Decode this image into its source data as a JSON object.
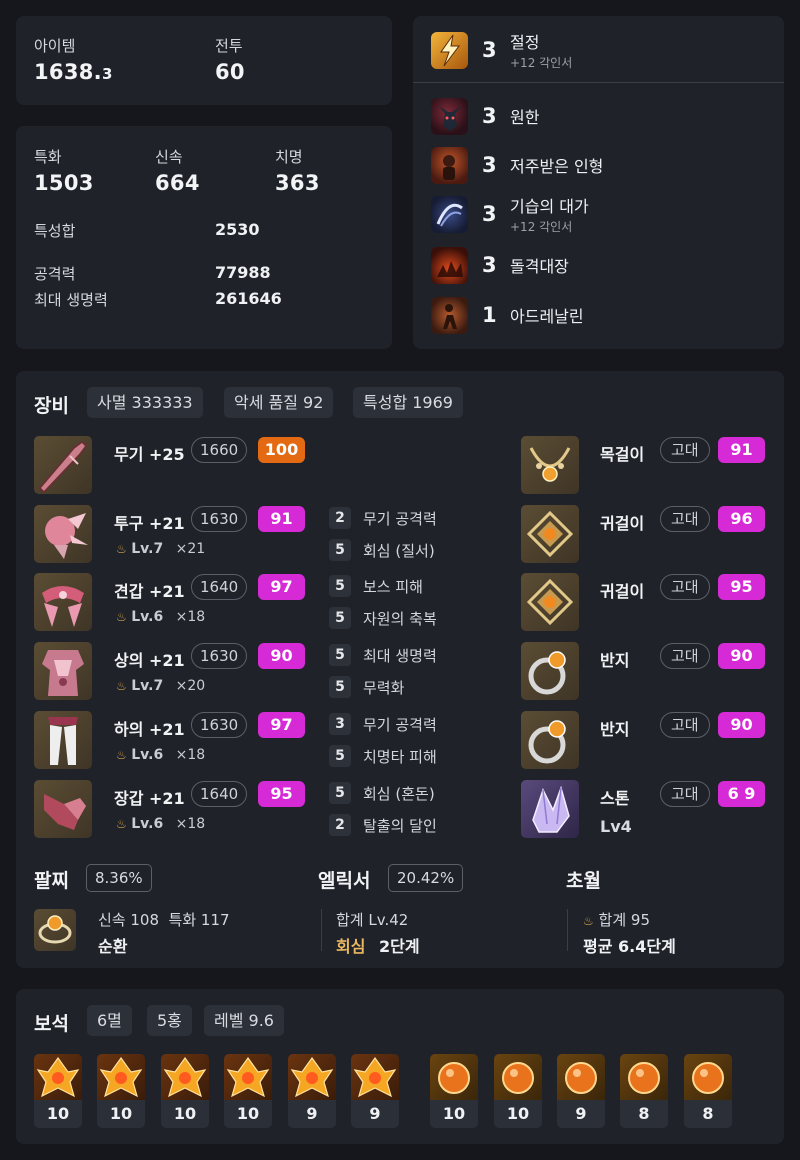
{
  "summary": {
    "item_label": "아이템",
    "item_value_main": "1638.",
    "item_value_decimal": "3",
    "combat_label": "전투",
    "combat_value": "60"
  },
  "stats": {
    "crit_label": "특화",
    "crit_value": "1503",
    "swift_label": "신속",
    "swift_value": "664",
    "fatal_label": "치명",
    "fatal_value": "363",
    "total_label": "특성합",
    "total_value": "2530",
    "atk_label": "공격력",
    "atk_value": "77988",
    "hp_label": "최대 생명력",
    "hp_value": "261646"
  },
  "engravings": [
    {
      "level": "3",
      "name": "절정",
      "sub": "+12 각인서",
      "icon": "lightning-icon"
    },
    {
      "level": "3",
      "name": "원한",
      "sub": "",
      "icon": "demon-icon"
    },
    {
      "level": "3",
      "name": "저주받은 인형",
      "sub": "",
      "icon": "doll-icon"
    },
    {
      "level": "3",
      "name": "기습의 대가",
      "sub": "+12 각인서",
      "icon": "ambush-icon"
    },
    {
      "level": "3",
      "name": "돌격대장",
      "sub": "",
      "icon": "charge-icon"
    },
    {
      "level": "1",
      "name": "아드레날린",
      "sub": "",
      "icon": "adrenaline-icon"
    }
  ],
  "equipment": {
    "title": "장비",
    "chips": [
      "사멸 333333",
      "악세 품질 92",
      "특성합 1969"
    ],
    "gear": [
      {
        "name": "무기 +25",
        "ilvl": "1660",
        "quality": "100",
        "lv": "",
        "mult": "",
        "icon": "weapon-icon"
      },
      {
        "name": "투구 +21",
        "ilvl": "1630",
        "quality": "91",
        "lv": "Lv.7",
        "mult": "×21",
        "icon": "helmet-icon"
      },
      {
        "name": "견갑 +21",
        "ilvl": "1640",
        "quality": "97",
        "lv": "Lv.6",
        "mult": "×18",
        "icon": "shoulder-icon"
      },
      {
        "name": "상의 +21",
        "ilvl": "1630",
        "quality": "90",
        "lv": "Lv.7",
        "mult": "×20",
        "icon": "chest-icon"
      },
      {
        "name": "하의 +21",
        "ilvl": "1630",
        "quality": "97",
        "lv": "Lv.6",
        "mult": "×18",
        "icon": "pants-icon"
      },
      {
        "name": "장갑 +21",
        "ilvl": "1640",
        "quality": "95",
        "lv": "Lv.6",
        "mult": "×18",
        "icon": "gloves-icon"
      }
    ],
    "elixirs": [
      {
        "n": "2",
        "t": "무기 공격력"
      },
      {
        "n": "5",
        "t": "회심 (질서)"
      },
      {
        "n": "5",
        "t": "보스 피해"
      },
      {
        "n": "5",
        "t": "자원의 축복"
      },
      {
        "n": "5",
        "t": "최대 생명력"
      },
      {
        "n": "5",
        "t": "무력화"
      },
      {
        "n": "3",
        "t": "무기 공격력"
      },
      {
        "n": "5",
        "t": "치명타 피해"
      },
      {
        "n": "5",
        "t": "회심 (혼돈)"
      },
      {
        "n": "2",
        "t": "탈출의 달인"
      }
    ],
    "accessories": [
      {
        "name": "목걸이",
        "grade": "고대",
        "quality": "91",
        "icon": "necklace-icon"
      },
      {
        "name": "귀걸이",
        "grade": "고대",
        "quality": "96",
        "icon": "earring-icon"
      },
      {
        "name": "귀걸이",
        "grade": "고대",
        "quality": "95",
        "icon": "earring-icon"
      },
      {
        "name": "반지",
        "grade": "고대",
        "quality": "90",
        "icon": "ring-icon"
      },
      {
        "name": "반지",
        "grade": "고대",
        "quality": "90",
        "icon": "ring-icon"
      },
      {
        "name": "스톤",
        "grade": "고대",
        "quality": "6 9",
        "icon": "stone-icon"
      }
    ],
    "stone_level": "Lv4"
  },
  "bracelet": {
    "title": "팔찌",
    "percent": "8.36%",
    "stats": "신속 108  특화 117",
    "effect": "순환"
  },
  "elixir": {
    "title": "엘릭서",
    "percent": "20.42%",
    "total": "합계 Lv.42",
    "effect_name": "회심",
    "effect_stage": "2단계"
  },
  "transcend": {
    "title": "초월",
    "total": "합계 95",
    "avg": "평균 6.4단계"
  },
  "gems": {
    "title": "보석",
    "chips": [
      "6멸",
      "5홍",
      "레벨 9.6"
    ],
    "levels": [
      "10",
      "10",
      "10",
      "10",
      "9",
      "9",
      "10",
      "10",
      "9",
      "8",
      "8"
    ]
  },
  "colors": {
    "quality_pink": "#d62ad6",
    "quality_orange": "#e36a12",
    "background": "#15171c",
    "card": "#1f2229"
  }
}
